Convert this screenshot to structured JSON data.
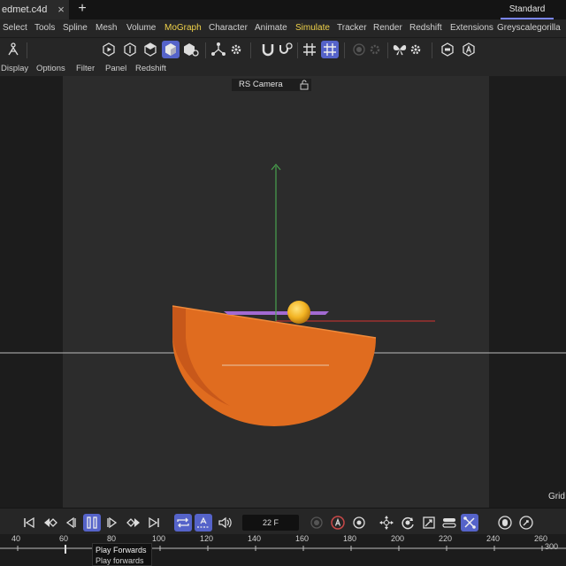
{
  "title_bar": {
    "file_tab": "edmet.c4d",
    "close_glyph": "×",
    "new_tab_glyph": "+",
    "layout": "Standard"
  },
  "menu": {
    "items": [
      "Select",
      "Tools",
      "Spline",
      "Mesh",
      "Volume",
      "MoGraph",
      "Character",
      "Animate",
      "Simulate",
      "Tracker",
      "Render",
      "Redshift",
      "Extensions",
      "Greyscalegorilla"
    ]
  },
  "toolbar": {
    "icons": [
      "person-icon",
      "play-circle-icon",
      "capsule-icon",
      "cube-icon",
      "cube-active-icon",
      "cube-gear-icon",
      "network-icon",
      "gear-icon",
      "magnet-icon",
      "magnet-gear-icon",
      "grid-icon",
      "grid-active-icon",
      "record-icon",
      "record-gear-icon",
      "butterfly-icon",
      "butterfly-gear-icon",
      "badge-icon",
      "a-circle-icon"
    ]
  },
  "viewport_menu": {
    "items": [
      "Display",
      "Options",
      "Filter",
      "Panel",
      "Redshift"
    ]
  },
  "viewport": {
    "camera": "RS Camera",
    "grid_label": "Grid",
    "colors": {
      "orange": "#e06c1f",
      "sphere": "#f2b322",
      "y_axis": "#49a24d",
      "x_axis": "#b3312f",
      "plane": "#9b5fc8"
    }
  },
  "timeline": {
    "current_frame": "22 F",
    "ruler_labels": [
      "40",
      "60",
      "80",
      "100",
      "120",
      "140",
      "160",
      "180",
      "200",
      "220",
      "240",
      "260"
    ],
    "ruler_end": "300",
    "tooltip": {
      "title": "Play Forwards",
      "subtitle": "Play forwards"
    }
  },
  "colors": {
    "accent": "#5563c9",
    "active_menu": "#f0d24a"
  }
}
